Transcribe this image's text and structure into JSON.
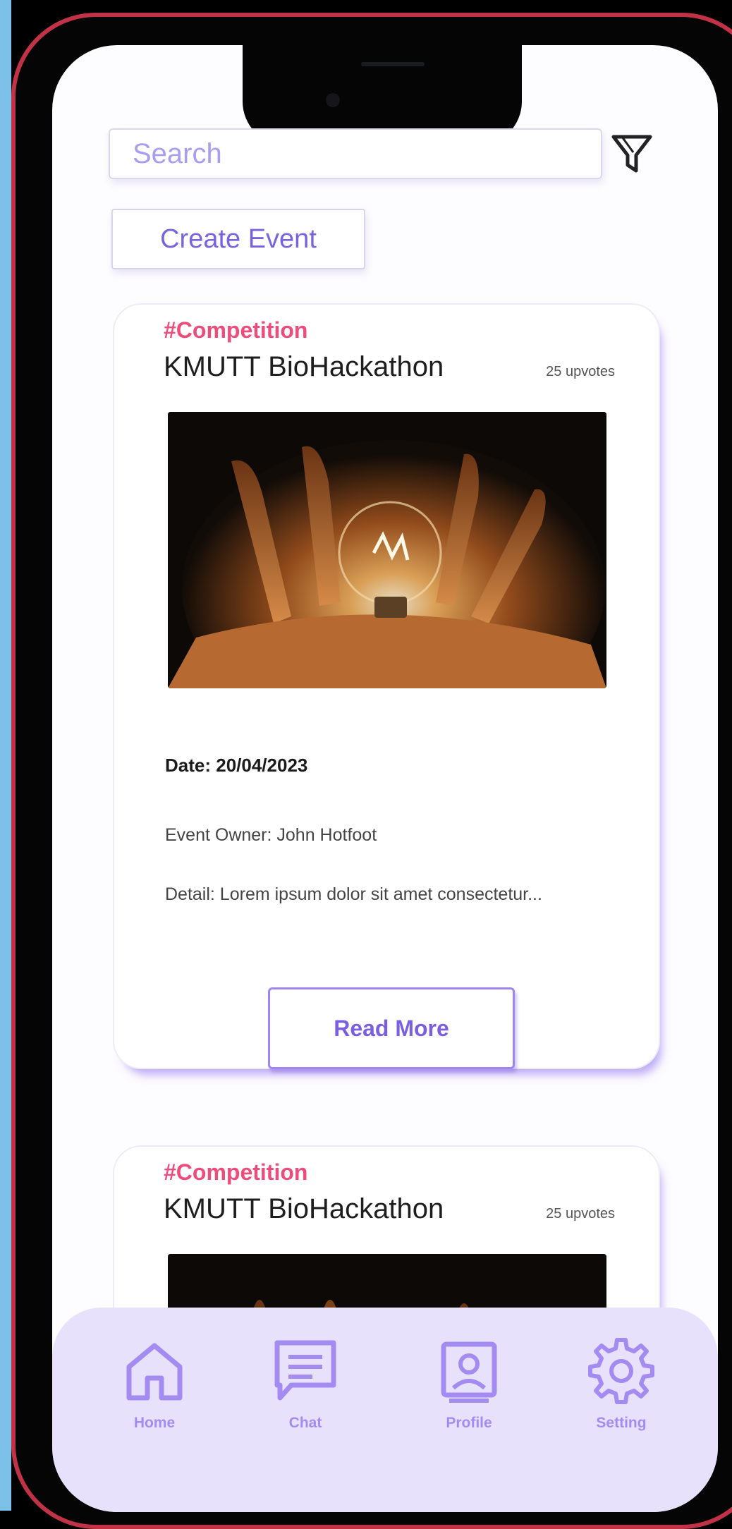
{
  "search": {
    "placeholder": "Search"
  },
  "actions": {
    "create_event": "Create Event"
  },
  "events": [
    {
      "tag": "#Competition",
      "title": "KMUTT BioHackathon",
      "upvotes": "25 upvotes",
      "date": "Date: 20/04/2023",
      "owner": "Event Owner: John Hotfoot",
      "detail": "Detail: Lorem ipsum dolor sit amet consectetur...",
      "read_more": "Read More"
    },
    {
      "tag": "#Competition",
      "title": "KMUTT BioHackathon",
      "upvotes": "25 upvotes"
    }
  ],
  "nav": {
    "items": [
      {
        "label": "Home",
        "icon": "home-icon"
      },
      {
        "label": "Chat",
        "icon": "chat-icon"
      },
      {
        "label": "Profile",
        "icon": "profile-icon"
      },
      {
        "label": "Setting",
        "icon": "gear-icon"
      }
    ]
  },
  "colors": {
    "accent": "#7a63e0",
    "tag": "#ee4d7c",
    "nav_background": "#e8e1fb",
    "frame": "#c23246"
  }
}
